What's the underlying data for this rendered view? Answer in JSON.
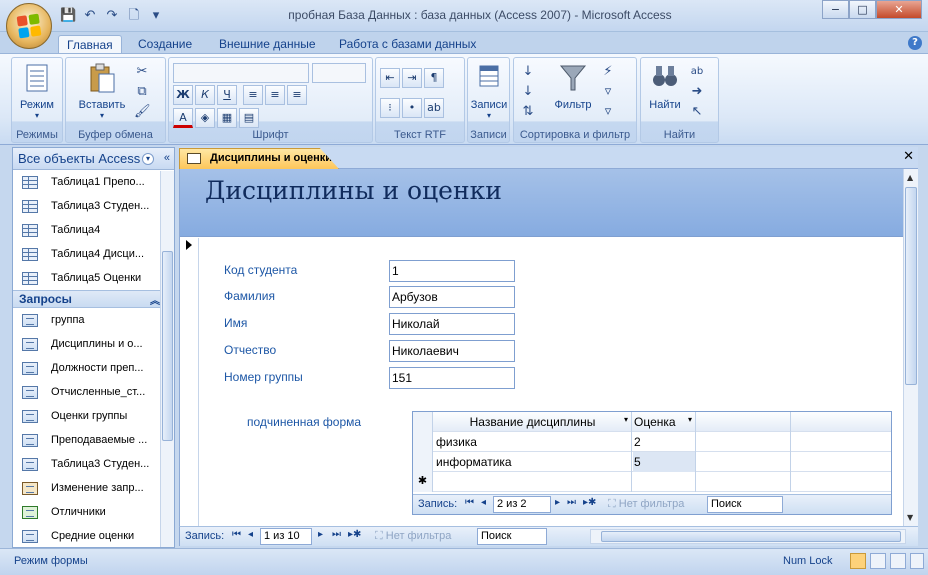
{
  "window": {
    "title": "пробная База Данных : база данных (Access 2007) - Microsoft Access",
    "minimize": "−",
    "maximize": "□",
    "close": "✕"
  },
  "ribbon_tabs": [
    "Главная",
    "Создание",
    "Внешние данные",
    "Работа с базами данных"
  ],
  "help": "?",
  "ribbon": {
    "groups": {
      "views": "Режимы",
      "clipboard": "Буфер обмена",
      "font": "Шрифт",
      "rtf": "Текст RTF",
      "records": "Записи",
      "sort_filter": "Сортировка и фильтр",
      "find": "Найти"
    },
    "buttons": {
      "view": "Режим",
      "paste": "Вставить",
      "records": "Записи",
      "filter": "Фильтр",
      "find": "Найти"
    },
    "font_buttons": {
      "bold": "Ж",
      "italic": "К",
      "underline": "Ч",
      "font_color": "A"
    }
  },
  "nav_pane": {
    "title": "Все объекты Access",
    "tables": [
      "Таблица1 Препо...",
      "Таблица3 Студен...",
      "Таблица4",
      "Таблица4 Дисци...",
      "Таблица5 Оценки"
    ],
    "queries_header": "Запросы",
    "queries": [
      "группа",
      "Дисциплины и о...",
      "Должности преп...",
      "Отчисленные_ст...",
      "Оценки группы",
      "Преподаваемые ...",
      "Таблица3 Студен...",
      "Изменение запр...",
      "Отличники",
      "Средние оценки"
    ]
  },
  "document": {
    "tab_label": "Дисциплины и оценки",
    "close": "✕",
    "form_title": "Дисциплины и оценки",
    "fields": [
      {
        "label": "Код студента",
        "value": "1"
      },
      {
        "label": "Фамилия",
        "value": "Арбузов"
      },
      {
        "label": "Имя",
        "value": "Николай"
      },
      {
        "label": "Отчество",
        "value": "Николаевич"
      },
      {
        "label": "Номер группы",
        "value": "151"
      }
    ],
    "subform": {
      "label": "подчиненная форма",
      "columns": [
        "Название дисциплины",
        "Оценка"
      ],
      "rows": [
        {
          "discipline": "физика",
          "grade": "2"
        },
        {
          "discipline": "информатика",
          "grade": "5"
        }
      ],
      "new_row_marker": "✱",
      "nav": {
        "label": "Запись:",
        "position": "2 из 2",
        "filter": "Нет фильтра",
        "search": "Поиск"
      }
    }
  },
  "record_nav": {
    "label": "Запись:",
    "position": "1 из 10",
    "filter": "Нет фильтра",
    "search": "Поиск"
  },
  "status": {
    "mode": "Режим формы",
    "numlock": "Num Lock"
  }
}
